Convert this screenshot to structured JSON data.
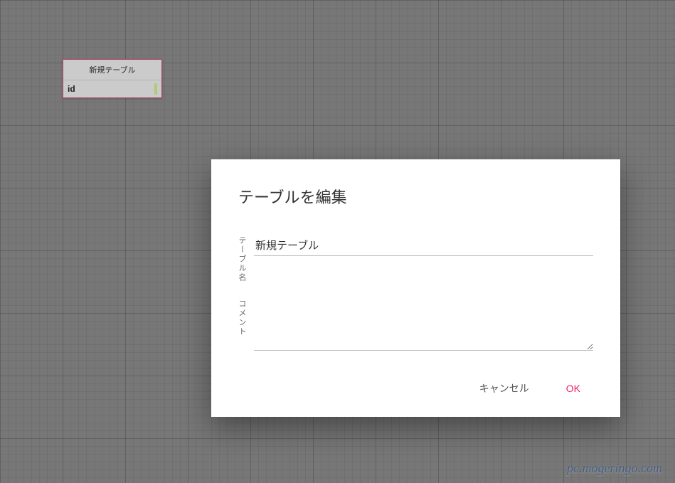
{
  "canvas": {
    "table": {
      "title": "新規テーブル",
      "columns": [
        {
          "name": "id"
        }
      ]
    }
  },
  "dialog": {
    "title": "テーブルを編集",
    "fields": {
      "table_name": {
        "label": "テーブル名",
        "value": "新規テーブル"
      },
      "comment": {
        "label": "コメント",
        "value": ""
      }
    },
    "actions": {
      "cancel": "キャンセル",
      "ok": "OK"
    }
  },
  "watermark": "pc.mogeringo.com"
}
